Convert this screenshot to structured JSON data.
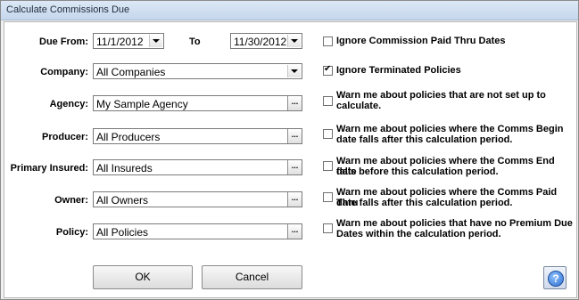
{
  "window": {
    "title": "Calculate Commissions Due"
  },
  "form": {
    "due_from_label": "Due From:",
    "due_from_value": "11/1/2012",
    "to_label": "To",
    "to_value": "11/30/2012",
    "company_label": "Company:",
    "company_value": "All Companies",
    "agency_label": "Agency:",
    "agency_value": "My Sample Agency",
    "producer_label": "Producer:",
    "producer_value": "All Producers",
    "primary_insured_label": "Primary Insured:",
    "primary_insured_value": "All Insureds",
    "owner_label": "Owner:",
    "owner_value": "All Owners",
    "policy_label": "Policy:",
    "policy_value": "All Policies",
    "browse_label": "..."
  },
  "options": [
    {
      "line1": "Ignore Commission Paid Thru Dates",
      "line2": "",
      "checked": false
    },
    {
      "line1": "Ignore Terminated Policies",
      "line2": "",
      "checked": true
    },
    {
      "line1": "Warn me about policies that are not set up to",
      "line2": "calculate.",
      "checked": false
    },
    {
      "line1": "Warn me about policies where the Comms Begin",
      "line2": "date falls after this calculation period.",
      "checked": false
    },
    {
      "line1": "Warn me about policies where the Comms End date",
      "line2": "falls before this calculation period.",
      "checked": false
    },
    {
      "line1": "Warn me about policies where the Comms Paid Thru",
      "line2": "date falls after this calculation period.",
      "checked": false
    },
    {
      "line1": "Warn me about policies that have no Premium Due",
      "line2": "Dates within the calculation period.",
      "checked": false
    }
  ],
  "buttons": {
    "ok": "OK",
    "cancel": "Cancel",
    "help": "?"
  }
}
